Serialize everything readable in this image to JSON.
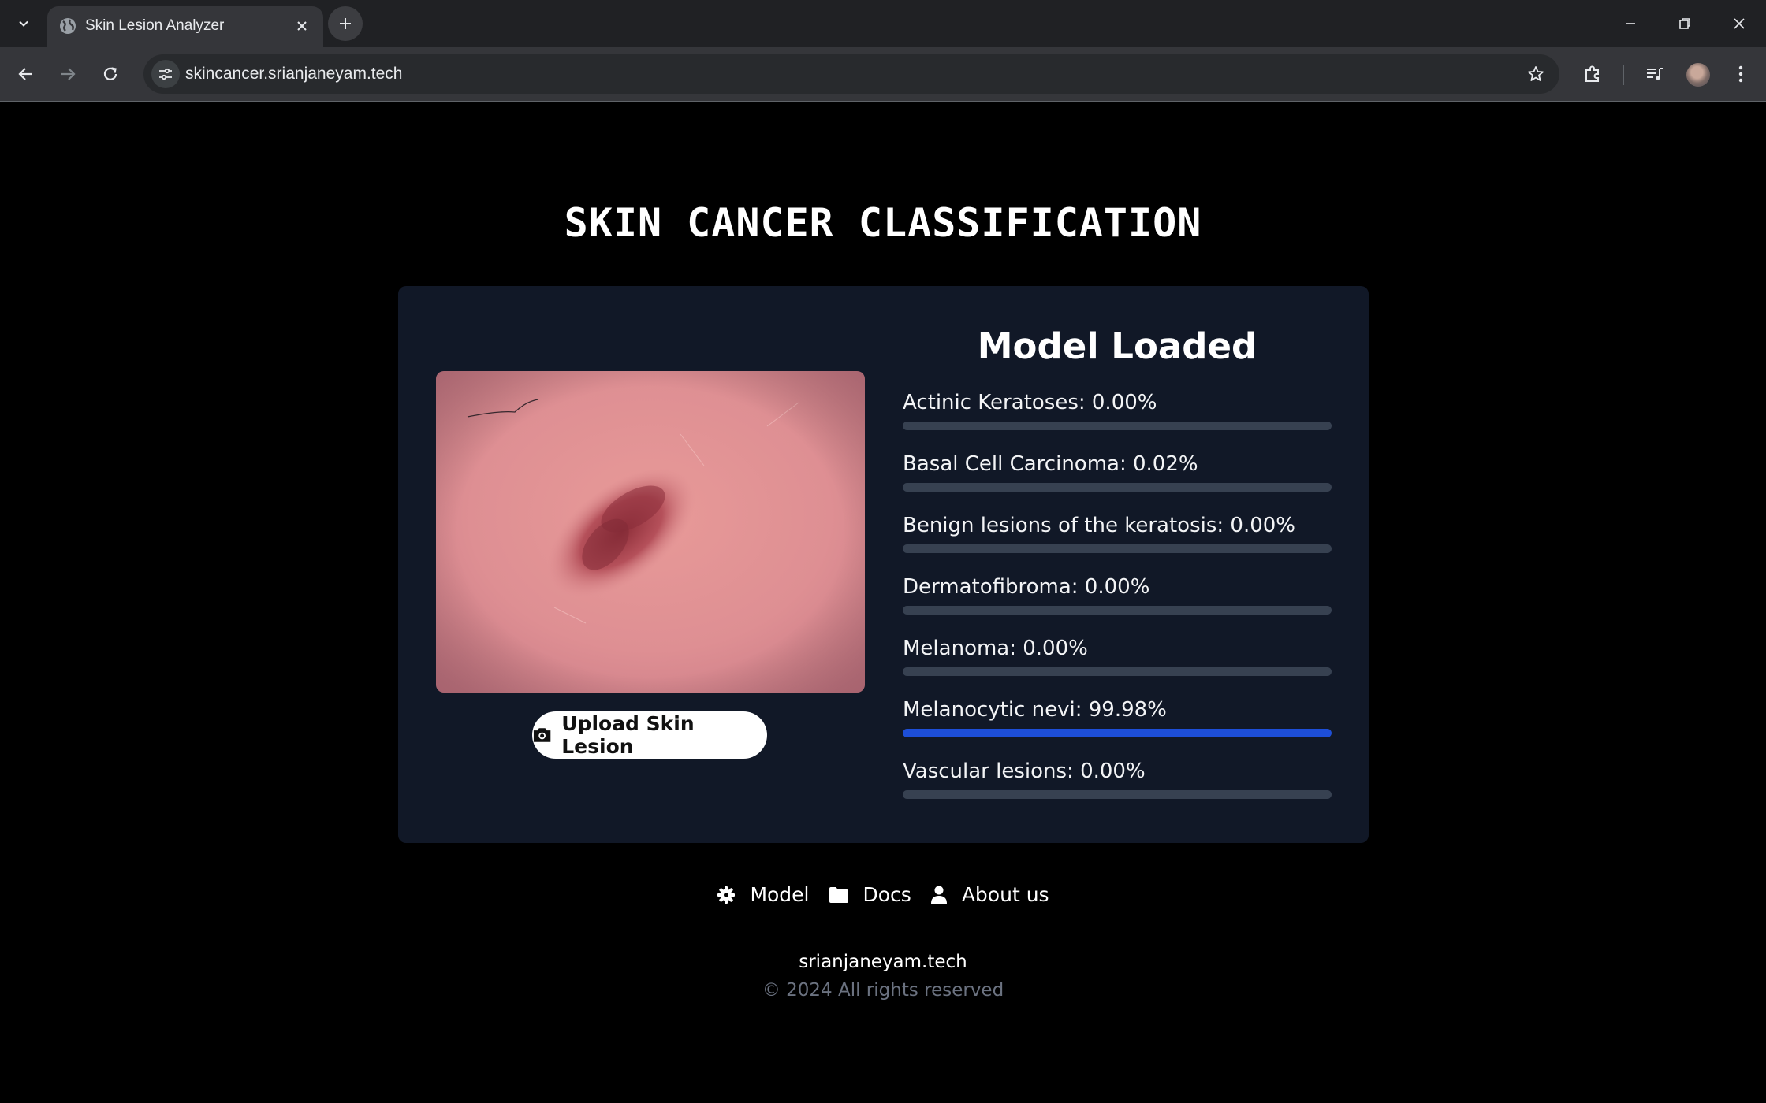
{
  "browser": {
    "tab_title": "Skin Lesion Analyzer",
    "url": "skincancer.srianjaneyam.tech"
  },
  "page": {
    "title": "SKIN CANCER CLASSIFICATION",
    "status": "Model Loaded",
    "upload_label": "Upload Skin Lesion",
    "accent_color": "#1d4ed8",
    "predictions": [
      {
        "label": "Actinic Keratoses: 0.00%",
        "probability": 0.0
      },
      {
        "label": "Basal Cell Carcinoma: 0.02%",
        "probability": 0.02
      },
      {
        "label": "Benign lesions of the keratosis: 0.00%",
        "probability": 0.0
      },
      {
        "label": "Dermatofibroma: 0.00%",
        "probability": 0.0
      },
      {
        "label": "Melanoma: 0.00%",
        "probability": 0.0
      },
      {
        "label": "Melanocytic nevi: 99.98%",
        "probability": 99.98
      },
      {
        "label": "Vascular lesions: 0.00%",
        "probability": 0.0
      }
    ]
  },
  "footer": {
    "nav": [
      {
        "label": "Model",
        "icon": "gear-icon"
      },
      {
        "label": "Docs",
        "icon": "folder-icon"
      },
      {
        "label": "About us",
        "icon": "user-icon"
      }
    ],
    "domain": "srianjaneyam.tech",
    "copyright": "© 2024 All rights reserved"
  }
}
